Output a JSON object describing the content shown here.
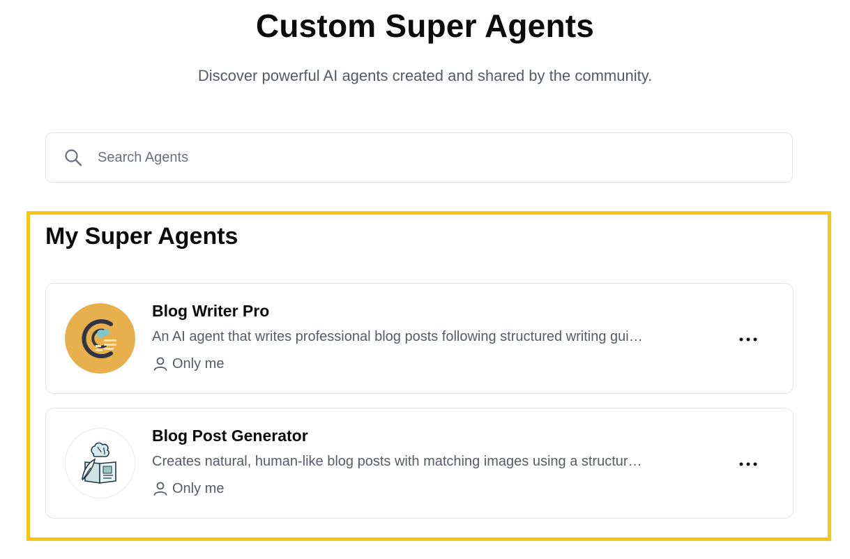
{
  "header": {
    "title": "Custom Super Agents",
    "subtitle": "Discover powerful AI agents created and shared by the community."
  },
  "search": {
    "placeholder": "Search Agents",
    "value": "",
    "icon": "search-icon"
  },
  "section": {
    "title": "My Super Agents",
    "highlight_color": "#f4c51b"
  },
  "agents": [
    {
      "name": "Blog Writer Pro",
      "description": "An AI agent that writes professional blog posts following structured writing guidelines",
      "visibility": "Only me",
      "avatar_bg": "#e8b04c",
      "avatar_icon": "writer-brain-icon",
      "menu_icon": "more-horizontal-icon"
    },
    {
      "name": "Blog Post Generator",
      "description": "Creates natural, human-like blog posts with matching images using a structured workflow",
      "visibility": "Only me",
      "avatar_bg": "#ffffff",
      "avatar_icon": "brain-book-quill-icon",
      "menu_icon": "more-horizontal-icon"
    }
  ]
}
